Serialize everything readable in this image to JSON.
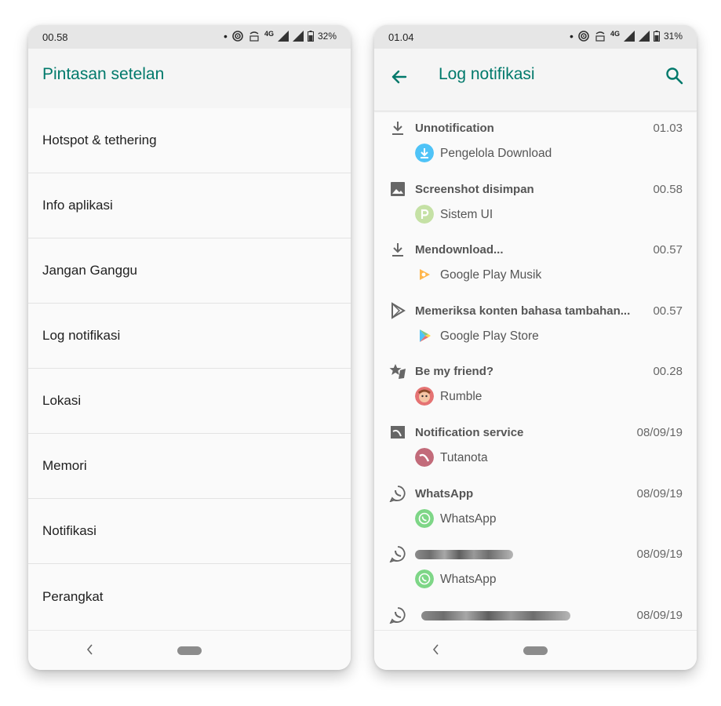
{
  "left_phone": {
    "status": {
      "time": "00.58",
      "network": "4G",
      "battery": "32%"
    },
    "title": "Pintasan setelan",
    "items": [
      "Hotspot & tethering",
      "Info aplikasi",
      "Jangan Ganggu",
      "Log notifikasi",
      "Lokasi",
      "Memori",
      "Notifikasi",
      "Perangkat"
    ]
  },
  "right_phone": {
    "status": {
      "time": "01.04",
      "network": "4G",
      "battery": "31%"
    },
    "title": "Log notifikasi",
    "notifications": [
      {
        "title": "Unnotification",
        "time": "01.03",
        "app": "Pengelola Download",
        "icon": "download-icon",
        "app_icon": "download-manager-icon"
      },
      {
        "title": "Screenshot disimpan",
        "time": "00.58",
        "app": "Sistem UI",
        "icon": "image-icon",
        "app_icon": "system-ui-icon"
      },
      {
        "title": "Mendownload...",
        "time": "00.57",
        "app": "Google Play Musik",
        "icon": "download-icon",
        "app_icon": "play-music-icon"
      },
      {
        "title": "Memeriksa konten bahasa tambahan...",
        "time": "00.57",
        "app": "Google Play Store",
        "icon": "play-store-icon",
        "app_icon": "play-store-app-icon"
      },
      {
        "title": "Be my friend?",
        "time": "00.28",
        "app": "Rumble",
        "icon": "star-badge-icon",
        "app_icon": "rumble-avatar"
      },
      {
        "title": "Notification service",
        "time": "08/09/19",
        "app": "Tutanota",
        "icon": "tutanota-icon",
        "app_icon": "tutanota-app-icon"
      },
      {
        "title": "WhatsApp",
        "time": "08/09/19",
        "app": "WhatsApp",
        "icon": "whatsapp-icon",
        "app_icon": "whatsapp-app-icon"
      },
      {
        "title": "",
        "time": "08/09/19",
        "app": "WhatsApp",
        "icon": "whatsapp-icon",
        "app_icon": "whatsapp-app-icon",
        "obscured": true
      },
      {
        "title": "",
        "time": "08/09/19",
        "app": "",
        "icon": "whatsapp-icon",
        "app_icon": "whatsapp-app-icon",
        "obscured": true
      }
    ]
  },
  "colors": {
    "accent": "#00796b",
    "whatsapp": "#4cd964",
    "download": "#4fc3f7"
  }
}
